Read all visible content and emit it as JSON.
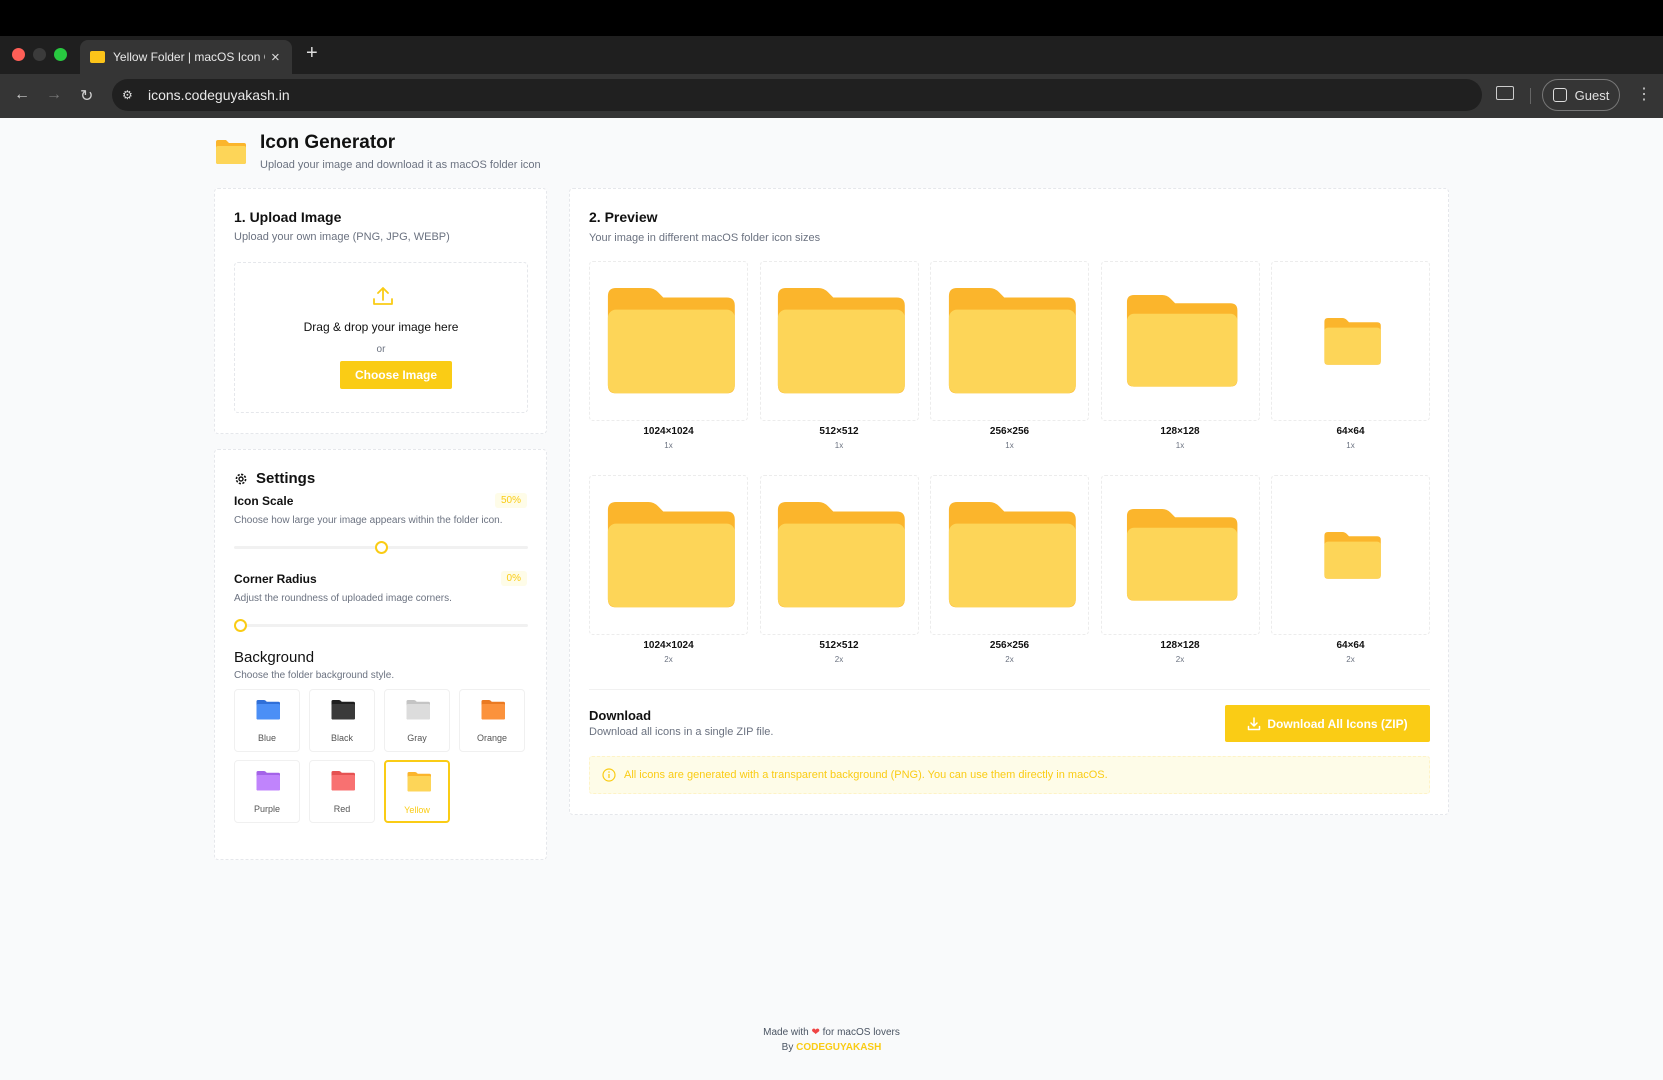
{
  "browser": {
    "tab_title": "Yellow Folder | macOS Icon G",
    "url": "icons.codeguyakash.in",
    "profile_label": "Guest"
  },
  "header": {
    "title": "Icon Generator",
    "subtitle": "Upload your image and download it as macOS folder icon"
  },
  "upload": {
    "title": "1. Upload Image",
    "description": "Upload your own image (PNG, JPG, WEBP)",
    "drop_text": "Drag & drop your image here",
    "or_text": "or",
    "button_label": "Choose Image"
  },
  "settings": {
    "title": "Settings",
    "icon_scale": {
      "label": "Icon Scale",
      "value_text": "50%",
      "value": 50,
      "description": "Choose how large your image appears within the folder icon."
    },
    "corner_radius": {
      "label": "Corner Radius",
      "value_text": "0%",
      "value": 0,
      "description": "Adjust the roundness of uploaded image corners."
    },
    "background": {
      "title": "Background",
      "description": "Choose the folder background style.",
      "options": [
        {
          "label": "Blue",
          "color": "#4b8ff6",
          "tab": "#2f6fd8"
        },
        {
          "label": "Black",
          "color": "#3a3a3a",
          "tab": "#1f1f1f"
        },
        {
          "label": "Gray",
          "color": "#dcdcdc",
          "tab": "#c4c4c4"
        },
        {
          "label": "Orange",
          "color": "#fb923c",
          "tab": "#ea7a22"
        },
        {
          "label": "Purple",
          "color": "#c084fc",
          "tab": "#a463e8"
        },
        {
          "label": "Red",
          "color": "#f87171",
          "tab": "#e55252"
        },
        {
          "label": "Yellow",
          "color": "#fdd558",
          "tab": "#fbb52c"
        }
      ],
      "selected": "Yellow"
    }
  },
  "preview": {
    "title": "2. Preview",
    "description": "Your image in different macOS folder icon sizes",
    "rows": [
      [
        {
          "size": "1024×1024",
          "scale": "1x"
        },
        {
          "size": "512×512",
          "scale": "1x"
        },
        {
          "size": "256×256",
          "scale": "1x"
        },
        {
          "size": "128×128",
          "scale": "1x"
        },
        {
          "size": "64×64",
          "scale": "1x"
        }
      ],
      [
        {
          "size": "1024×1024",
          "scale": "2x"
        },
        {
          "size": "512×512",
          "scale": "2x"
        },
        {
          "size": "256×256",
          "scale": "2x"
        },
        {
          "size": "128×128",
          "scale": "2x"
        },
        {
          "size": "64×64",
          "scale": "2x"
        }
      ]
    ]
  },
  "download": {
    "title": "Download",
    "description": "Download all icons in a single ZIP file.",
    "button_label": "Download All Icons (ZIP)",
    "note": "All icons are generated with a transparent background (PNG). You can use them directly in macOS."
  },
  "footer": {
    "line1_prefix": "Made with",
    "heart": "❤",
    "line1_suffix": "for macOS lovers",
    "line2_prefix": "By",
    "brand": "CODEGUYAKASH"
  },
  "colors": {
    "accent": "#facc15",
    "folder_body": "#fdd558",
    "folder_tab": "#fbb52c"
  }
}
